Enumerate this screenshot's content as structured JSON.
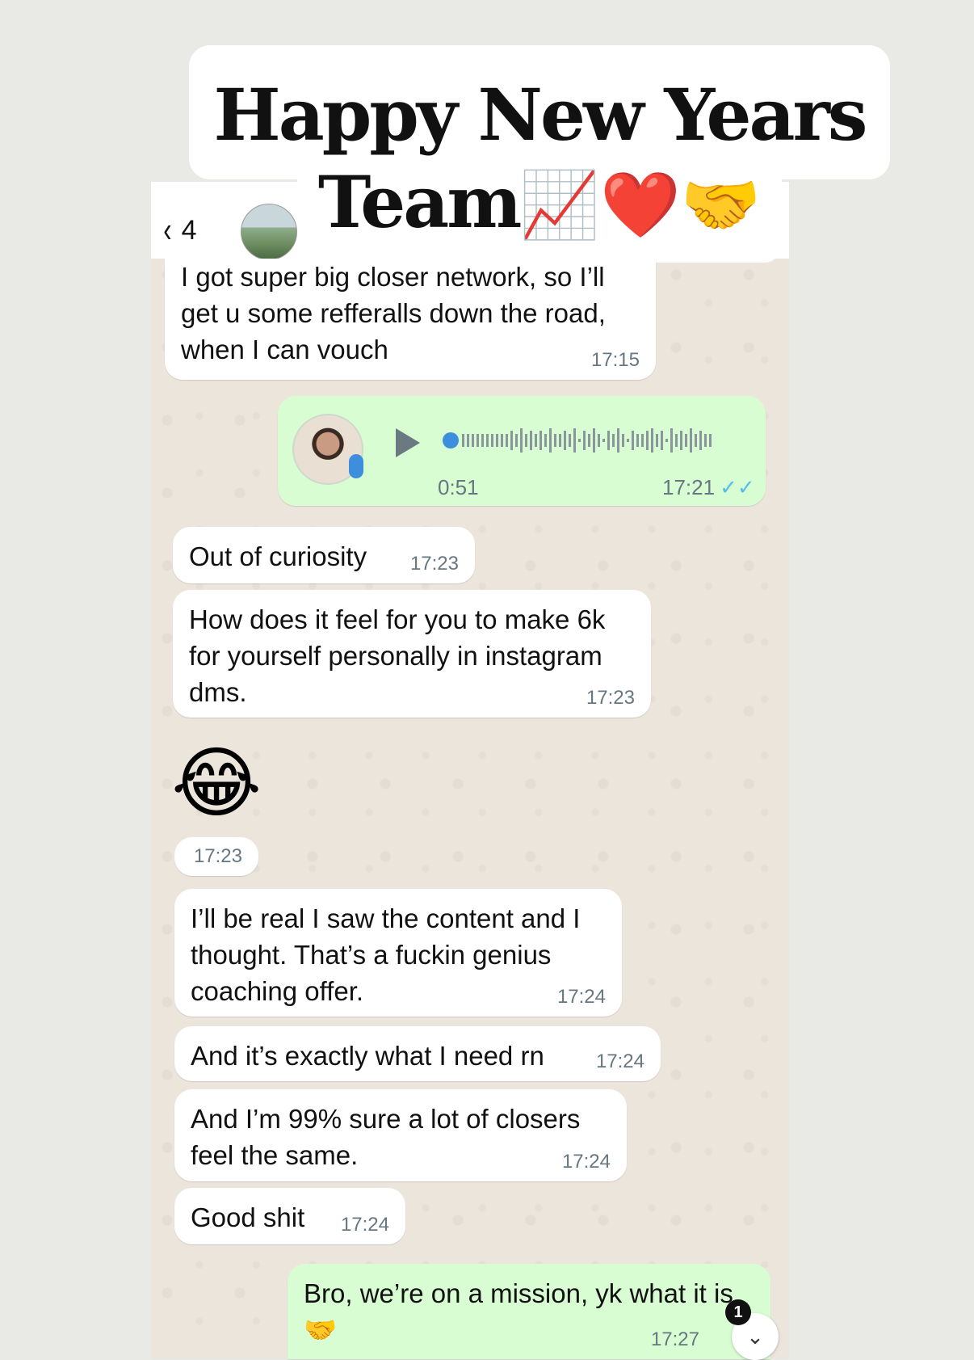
{
  "overlay": {
    "title_line1": "Happy New Years",
    "title_line2": "Team",
    "title_emojis": "📈❤️🤝"
  },
  "header": {
    "back_glyph": "‹",
    "unread_count": "4"
  },
  "messages": [
    {
      "direction": "in",
      "text": "I got super big closer network, so I’ll get u some refferalls down the road, when I can vouch",
      "time": "17:15"
    },
    {
      "direction": "out",
      "type": "voice",
      "duration": "0:51",
      "time": "17:21",
      "status": "read"
    },
    {
      "direction": "in",
      "text": "Out of curiosity",
      "time": "17:23"
    },
    {
      "direction": "in",
      "text": "How does it feel for you to make 6k for yourself personally in instagram dms.",
      "time": "17:23"
    },
    {
      "direction": "in",
      "type": "emoji",
      "text": "😂",
      "time": "17:23"
    },
    {
      "direction": "in",
      "text": "I’ll be real I saw the content and I thought. That’s a fuckin genius coaching offer.",
      "time": "17:24"
    },
    {
      "direction": "in",
      "text": "And it’s exactly what I need rn",
      "time": "17:24"
    },
    {
      "direction": "in",
      "text": "And I’m 99% sure a lot of closers feel the same.",
      "time": "17:24"
    },
    {
      "direction": "in",
      "text": "Good shit",
      "time": "17:24"
    },
    {
      "direction": "out",
      "text": "Bro, we’re on a mission, yk what it is",
      "emoji": "🤝",
      "time": "17:27"
    }
  ],
  "scroll": {
    "badge": "1",
    "icon": "chevron-down-icon"
  },
  "colors": {
    "incoming_bubble": "#ffffff",
    "outgoing_bubble": "#d9fdd3",
    "chat_background": "#ece5dc",
    "read_ticks": "#53bdeb"
  }
}
